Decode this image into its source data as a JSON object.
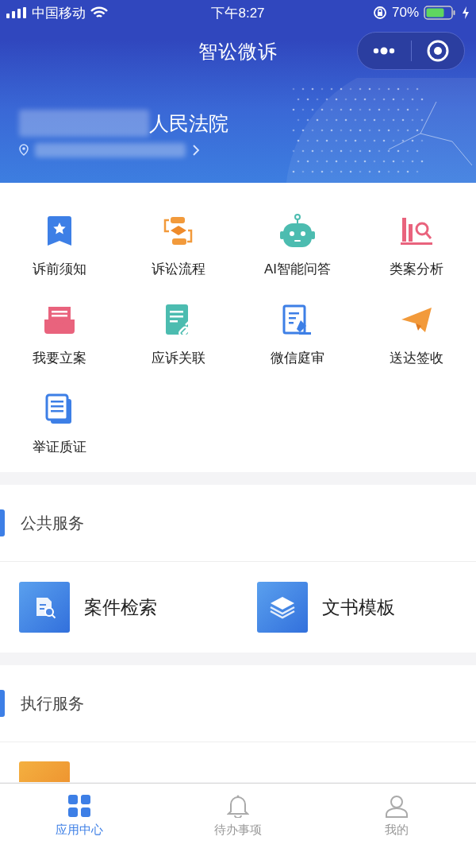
{
  "status_bar": {
    "carrier": "中国移动",
    "time": "下午8:27",
    "battery": "70%"
  },
  "nav_bar": {
    "title": "智讼微诉"
  },
  "banner": {
    "court_suffix": "人民法院"
  },
  "apps": [
    {
      "label": "诉前须知"
    },
    {
      "label": "诉讼流程"
    },
    {
      "label": "AI智能问答"
    },
    {
      "label": "类案分析"
    },
    {
      "label": "我要立案"
    },
    {
      "label": "应诉关联"
    },
    {
      "label": "微信庭审"
    },
    {
      "label": "送达签收"
    },
    {
      "label": "举证质证"
    }
  ],
  "sections": [
    {
      "title": "公共服务",
      "items": [
        {
          "kind": "full",
          "label": "案件检索"
        },
        {
          "kind": "full",
          "label": "文书模板"
        }
      ]
    },
    {
      "title": "执行服务",
      "items": [
        {
          "kind": "partial"
        }
      ]
    }
  ],
  "tabs": [
    {
      "label": "应用中心",
      "selected": true
    },
    {
      "label": "待办事项",
      "selected": false
    },
    {
      "label": "我的",
      "selected": false
    }
  ]
}
